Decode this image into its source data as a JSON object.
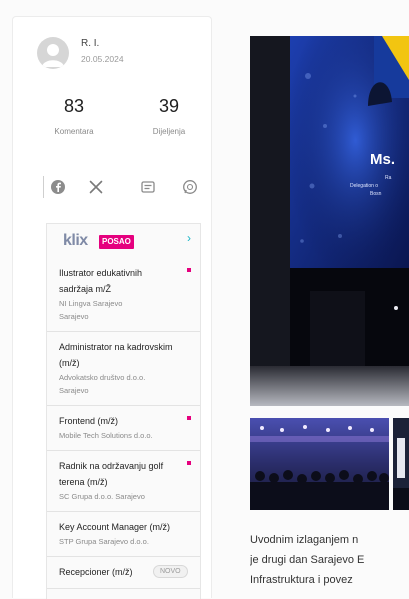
{
  "author": {
    "name": "R. I.",
    "date": "20.05.2024"
  },
  "stats": {
    "comments": {
      "value": "83",
      "label": "Komentara"
    },
    "shares": {
      "value": "39",
      "label": "Dijeljenja"
    }
  },
  "share_bar": {
    "icons": [
      "facebook-icon",
      "x-icon",
      "message-icon",
      "whatsapp-icon"
    ]
  },
  "jobs_widget": {
    "brand": "klix",
    "badge": "POSAO",
    "more_icon": "chevron-right-icon",
    "more_glyph": "›",
    "items": [
      {
        "title": "Ilustrator edukativnih sadržaja m/Ž",
        "company": "NI Lingva Sarajevo",
        "location": "Sarajevo",
        "highlighted": true
      },
      {
        "title": "Administrator na kadrovskim (m/ž)",
        "company": "Advokatsko društvo d.o.o.",
        "location": "Sarajevo",
        "highlighted": false
      },
      {
        "title": "Frontend (m/ž)",
        "company": "Mobile Tech Solutions d.o.o.",
        "highlighted": true
      },
      {
        "title": "Radnik na održavanju golf terena (m/ž)",
        "company": "SC Grupa d.o.o. Sarajevo",
        "highlighted": true
      },
      {
        "title": "Key Account Manager (m/ž)",
        "company": "STP Grupa Sarajevo d.o.o.",
        "highlighted": false
      },
      {
        "title": "Recepcioner (m/ž)",
        "badge": "NOVO",
        "highlighted": false
      }
    ]
  },
  "article": {
    "main_image": {
      "screen_title": "Ms.",
      "screen_lines": [
        "Ra",
        "Delegation o",
        "Bosn"
      ]
    },
    "caption_lines": [
      "Uvodnim izlaganjem n",
      "je drugi dan Sarajevo E",
      "Infrastruktura i povez"
    ]
  },
  "colors": {
    "brand_magenta": "#e5007e",
    "brand_gray": "#7f8aa6",
    "accent_teal": "#19b5c6",
    "screen_blue": "#1d3fb0",
    "flag_yellow": "#f2c511"
  }
}
